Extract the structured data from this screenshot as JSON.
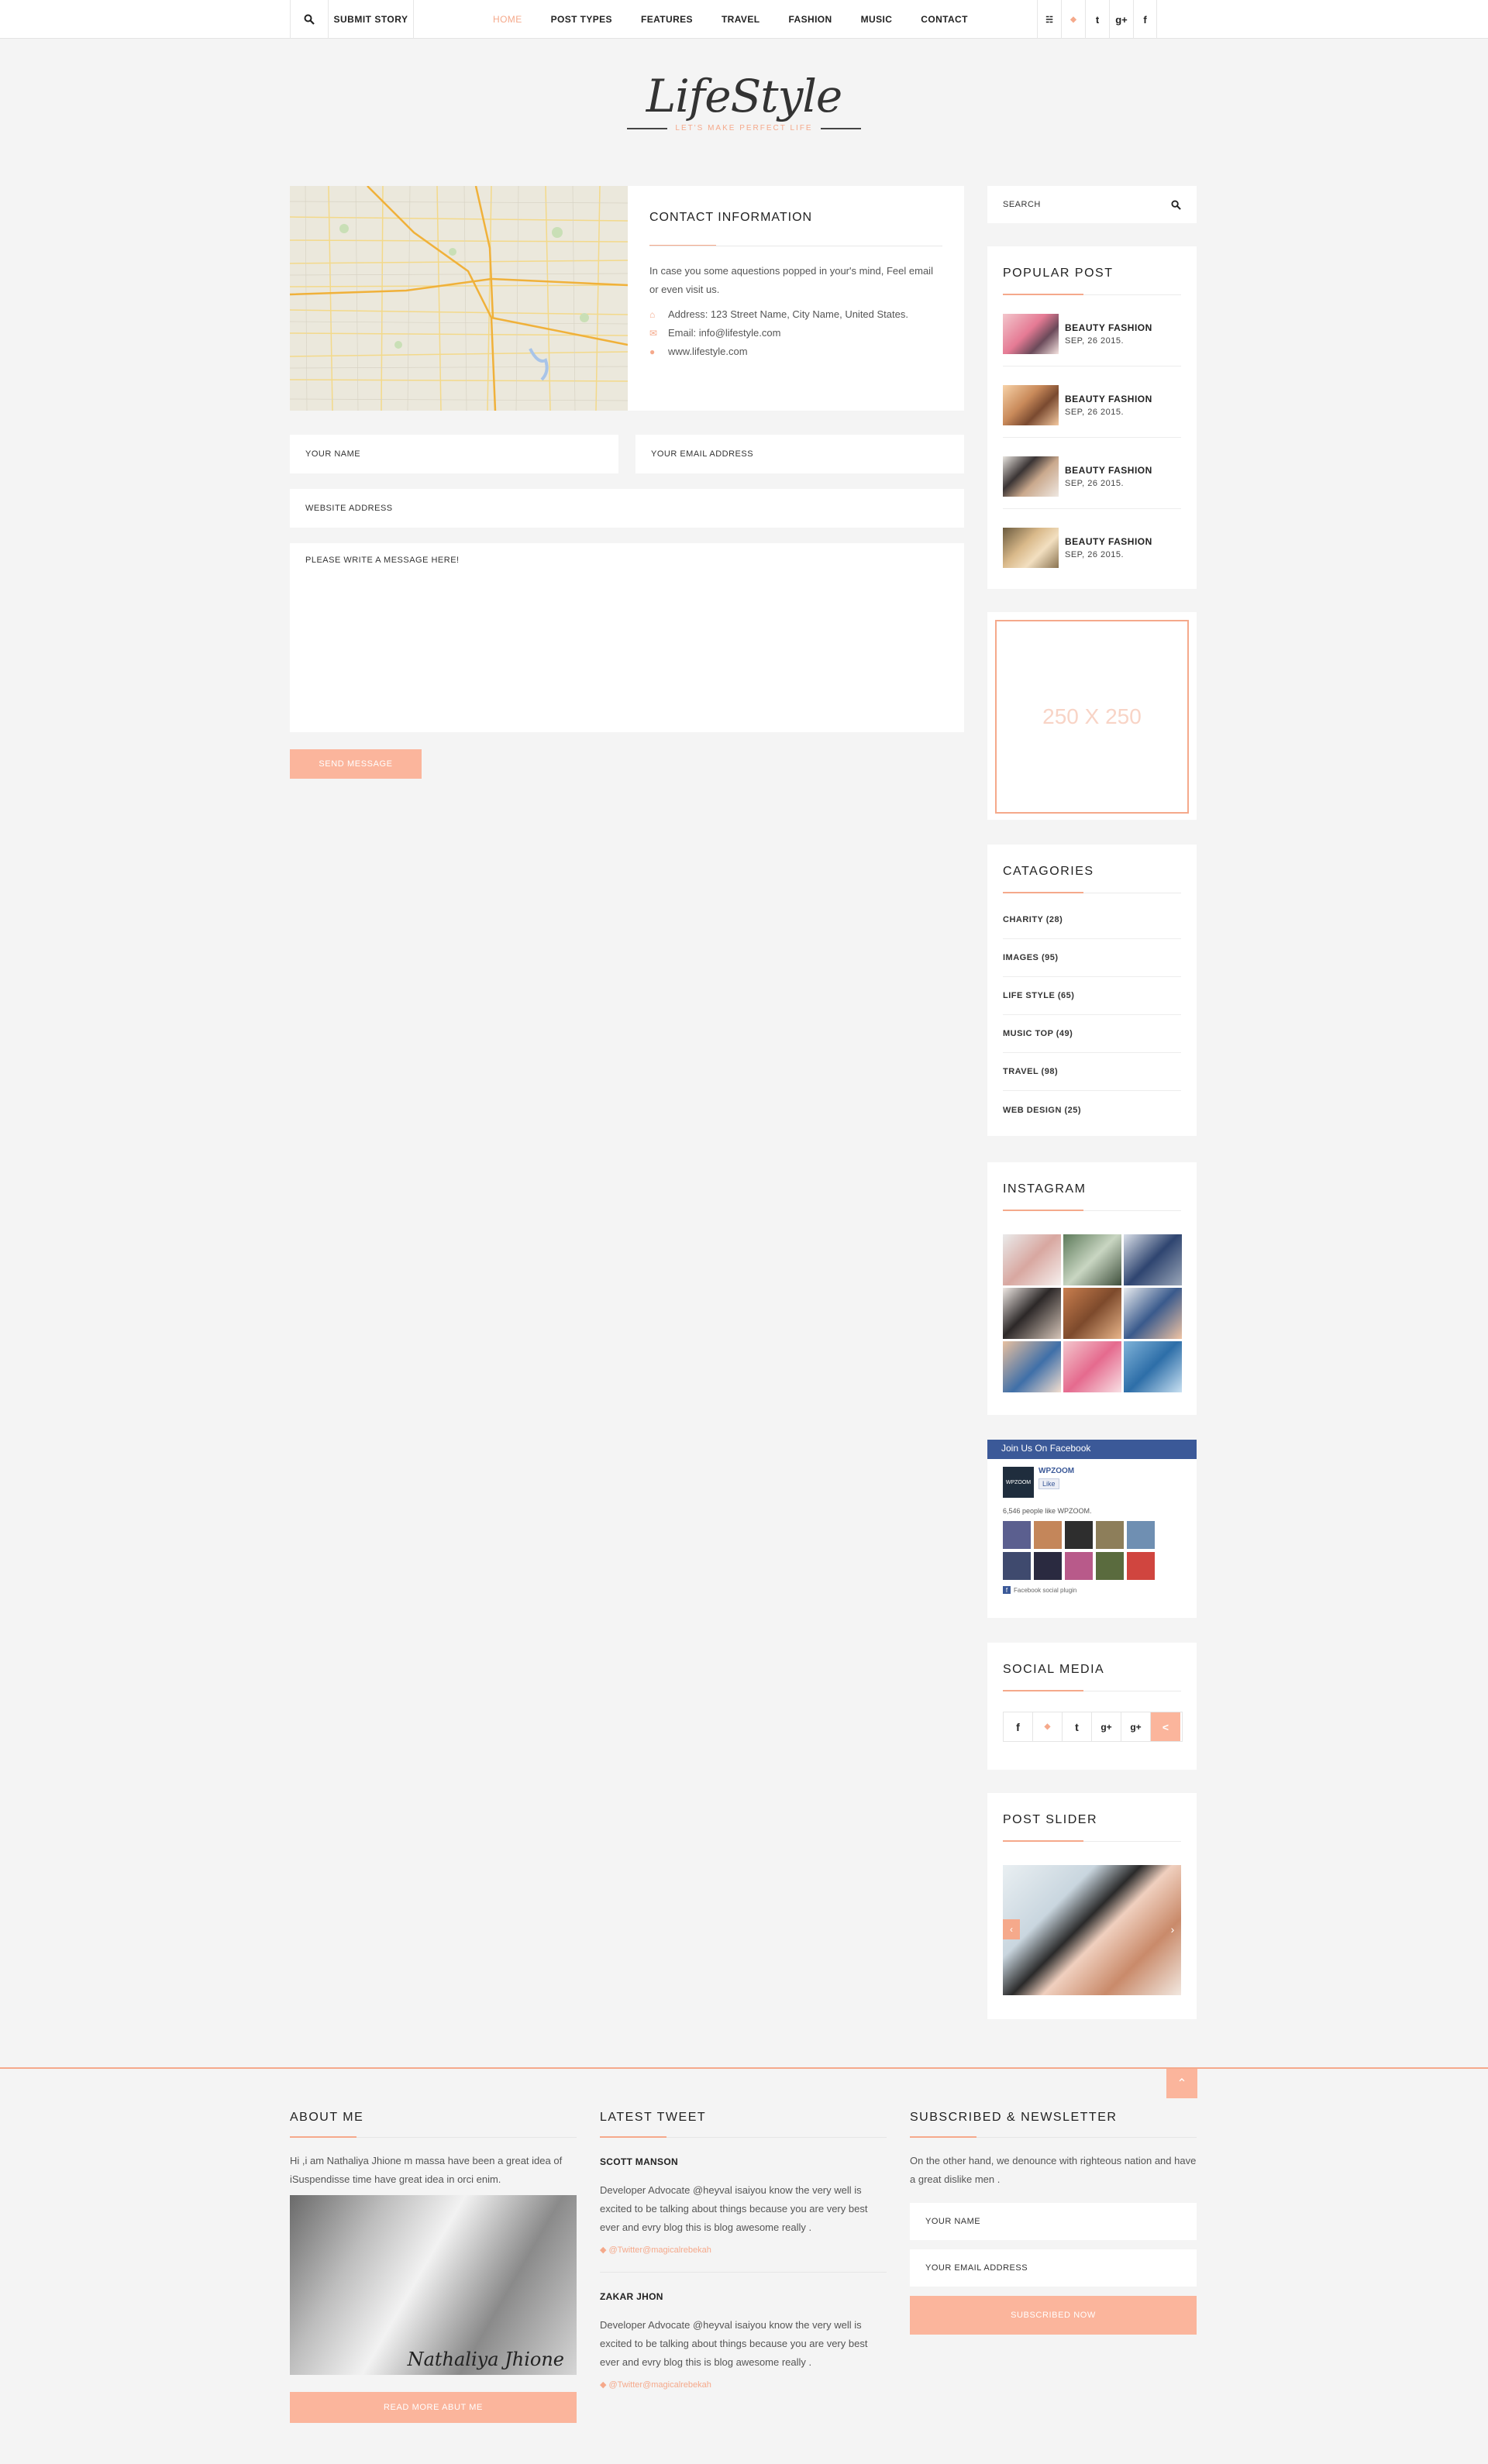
{
  "topbar": {
    "submit_label": "SUBMIT STORY",
    "nav": [
      "HOME",
      "POST TYPES",
      "FEATURES",
      "TRAVEL",
      "FASHION",
      "MUSIC",
      "CONTACT"
    ],
    "social_icons": [
      {
        "name": "rss-icon",
        "glyph": "☵"
      },
      {
        "name": "twitter-icon",
        "glyph": "◆"
      },
      {
        "name": "tumblr-icon",
        "glyph": "t"
      },
      {
        "name": "google-plus-icon",
        "glyph": "g+"
      },
      {
        "name": "facebook-icon",
        "glyph": "f"
      }
    ]
  },
  "logo": {
    "title": "LifeStyle",
    "tagline": "LET'S MAKE PERFECT LIFE"
  },
  "contact": {
    "title": "CONTACT INFORMATION",
    "intro": "In case you some aquestions popped in your's mind, Feel email or even visit us.",
    "address": "Address: 123 Street Name, City Name, United States.",
    "email": "Email: info@lifestyle.com",
    "web": "www.lifestyle.com"
  },
  "form": {
    "name_placeholder": "YOUR NAME",
    "email_placeholder": "YOUR EMAIL ADDRESS",
    "website_placeholder": "WEBSITE ADDRESS",
    "message_placeholder": "PLEASE WRITE A MESSAGE HERE!",
    "send_label": "SEND MESSAGE"
  },
  "sidebar": {
    "search_placeholder": "SEARCH",
    "popular_title": "POPULAR POST",
    "popular_posts": [
      {
        "title": "BEAUTY FASHION",
        "date": "SEP, 26 2015."
      },
      {
        "title": "BEAUTY FASHION",
        "date": "SEP, 26 2015."
      },
      {
        "title": "BEAUTY FASHION",
        "date": "SEP, 26 2015."
      },
      {
        "title": "BEAUTY FASHION",
        "date": "SEP, 26 2015."
      }
    ],
    "ad_label": "250 X 250",
    "categories_title": "CATAGORIES",
    "categories": [
      "CHARITY  (28)",
      "IMAGES  (95)",
      "LIFE STYLE  (65)",
      "MUSIC TOP  (49)",
      "TRAVEL  (98)",
      "WEB DESIGN  (25)"
    ],
    "instagram_title": "INSTAGRAM",
    "facebook": {
      "header": "Join Us On Facebook",
      "page_name": "WPZOOM",
      "like_label": "Like",
      "count_text": "6,546 people like WPZOOM.",
      "plugin_text": "Facebook social plugin"
    },
    "social_title": "SOCIAL MEDIA",
    "social_icons": [
      {
        "name": "facebook-icon",
        "glyph": "f"
      },
      {
        "name": "twitter-icon",
        "glyph": "◆"
      },
      {
        "name": "tumblr-icon",
        "glyph": "t"
      },
      {
        "name": "google-plus-icon",
        "glyph": "g+"
      },
      {
        "name": "google-plus-icon",
        "glyph": "g+"
      },
      {
        "name": "share-icon",
        "glyph": "<"
      }
    ],
    "slider_title": "POST SLIDER"
  },
  "footer": {
    "about_title": "ABOUT ME",
    "about_text": "Hi ,i am Nathaliya Jhione m massa have been a great idea of iSuspendisse time have great idea in orci enim.",
    "signature": "Nathaliya Jhione",
    "about_button": "READ MORE ABUT ME",
    "tweet_title": "LATEST TWEET",
    "tweets": [
      {
        "name": "SCOTT MANSON",
        "text": "Developer Advocate @heyval isaiyou know the very well is excited to be talking about things because you are very best ever and evry blog this is blog awesome really .",
        "link": "@Twitter@magicalrebekah"
      },
      {
        "name": "ZAKAR JHON",
        "text": "Developer Advocate @heyval isaiyou know the very well is excited to be talking about things because you are very best ever and evry blog this is blog awesome really .",
        "link": "@Twitter@magicalrebekah"
      }
    ],
    "newsletter_title": "SUBSCRIBED & NEWSLETTER",
    "newsletter_text": "On the other hand, we denounce with righteous nation and have a great dislike men .",
    "nl_name": "YOUR NAME",
    "nl_email": "YOUR EMAIL ADDRESS",
    "nl_button": "SUBSCRIBED NOW"
  }
}
